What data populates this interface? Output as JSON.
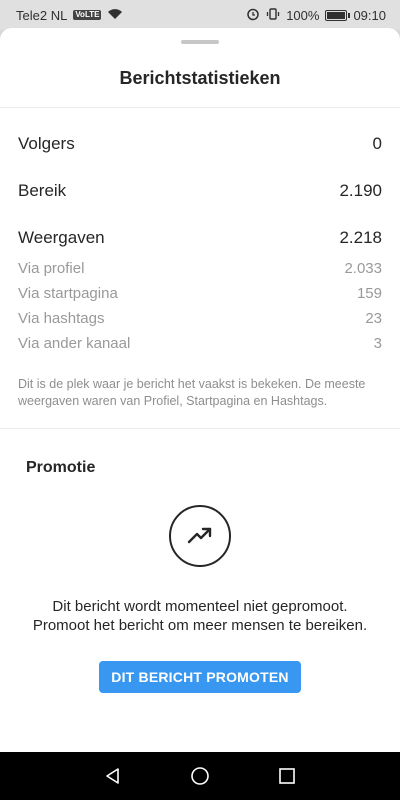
{
  "status_bar": {
    "carrier": "Tele2 NL",
    "volte": "VoLTE",
    "battery": "100%",
    "time": "09:10"
  },
  "sheet": {
    "title": "Berichtstatistieken"
  },
  "stats": {
    "volgers": {
      "label": "Volgers",
      "value": "0"
    },
    "bereik": {
      "label": "Bereik",
      "value": "2.190"
    },
    "weergaven": {
      "label": "Weergaven",
      "value": "2.218"
    },
    "sources": [
      {
        "label": "Via profiel",
        "value": "2.033"
      },
      {
        "label": "Via startpagina",
        "value": "159"
      },
      {
        "label": "Via hashtags",
        "value": "23"
      },
      {
        "label": "Via ander kanaal",
        "value": "3"
      }
    ],
    "info": "Dit is de plek waar je bericht het vaakst is bekeken. De meeste weergaven waren van Profiel, Startpagina en Hashtags."
  },
  "promotion": {
    "title": "Promotie",
    "icon": "trending-up-icon",
    "text": "Dit bericht wordt momenteel niet gepromoot. Promoot het bericht om meer mensen te bereiken.",
    "button_label": "DIT BERICHT PROMOTEN"
  },
  "colors": {
    "accent": "#3897f0",
    "text": "#262626",
    "muted": "#999999"
  }
}
